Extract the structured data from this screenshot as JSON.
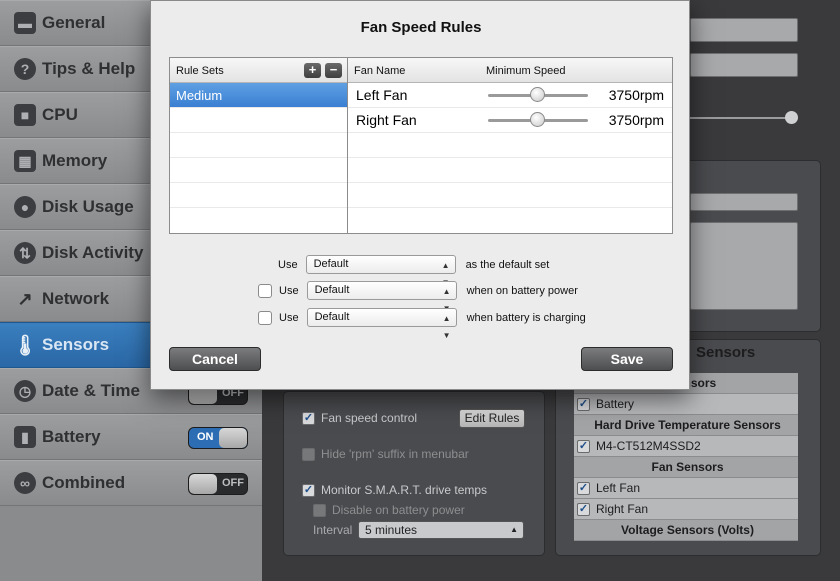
{
  "sidebar": {
    "items": [
      {
        "label": "General",
        "icon": "general-icon",
        "glyph": "▬"
      },
      {
        "label": "Tips & Help",
        "icon": "help-icon",
        "glyph": "?"
      },
      {
        "label": "CPU",
        "icon": "cpu-icon",
        "glyph": "■"
      },
      {
        "label": "Memory",
        "icon": "memory-icon",
        "glyph": "▦"
      },
      {
        "label": "Disk Usage",
        "icon": "disk-usage-icon",
        "glyph": "●"
      },
      {
        "label": "Disk Activity",
        "icon": "disk-activity-icon",
        "glyph": "⇅"
      },
      {
        "label": "Network",
        "icon": "network-icon",
        "glyph": "↗"
      },
      {
        "label": "Sensors",
        "icon": "thermometer-icon",
        "glyph": "🌡"
      },
      {
        "label": "Date & Time",
        "icon": "clock-icon",
        "glyph": "◷"
      },
      {
        "label": "Battery",
        "icon": "battery-icon",
        "glyph": "▮"
      },
      {
        "label": "Combined",
        "icon": "combined-icon",
        "glyph": "∞"
      }
    ],
    "toggles": {
      "date_time": "OFF",
      "battery": "ON",
      "combined": "OFF"
    }
  },
  "sensors_panel": {
    "fan_speed_control": "Fan speed control",
    "edit_rules": "Edit Rules",
    "hide_rpm": "Hide 'rpm' suffix in menubar",
    "monitor_smart": "Monitor S.M.A.R.T. drive temps",
    "disable_battery": "Disable on battery power",
    "interval_label": "Interval",
    "interval_value": "5 minutes",
    "list_title": "Sensors",
    "list": {
      "hdr_partial": "e Sensors",
      "battery": "Battery",
      "hdd_hdr": "Hard Drive Temperature Sensors",
      "drive": "M4-CT512M4SSD2",
      "fan_hdr": "Fan Sensors",
      "left_fan": "Left Fan",
      "right_fan": "Right Fan",
      "voltage_hdr": "Voltage Sensors (Volts)"
    }
  },
  "dialog": {
    "title": "Fan Speed Rules",
    "rule_sets_header": "Rule Sets",
    "add_glyph": "+",
    "remove_glyph": "−",
    "rule_sets": [
      "Medium"
    ],
    "fan_name_header": "Fan Name",
    "min_speed_header": "Minimum Speed",
    "fans": [
      {
        "name": "Left Fan",
        "speed": "3750rpm",
        "slider_fraction": 0.5
      },
      {
        "name": "Right Fan",
        "speed": "3750rpm",
        "slider_fraction": 0.5
      }
    ],
    "use_rows": [
      {
        "use": "Use",
        "select": "Default",
        "suffix": "as the default set"
      },
      {
        "use": "Use",
        "select": "Default",
        "suffix": "when on battery power"
      },
      {
        "use": "Use",
        "select": "Default",
        "suffix": "when battery is charging"
      }
    ],
    "cancel": "Cancel",
    "save": "Save"
  },
  "colors": {
    "accent": "#2d6db3",
    "selection": "#3a7fd2"
  }
}
